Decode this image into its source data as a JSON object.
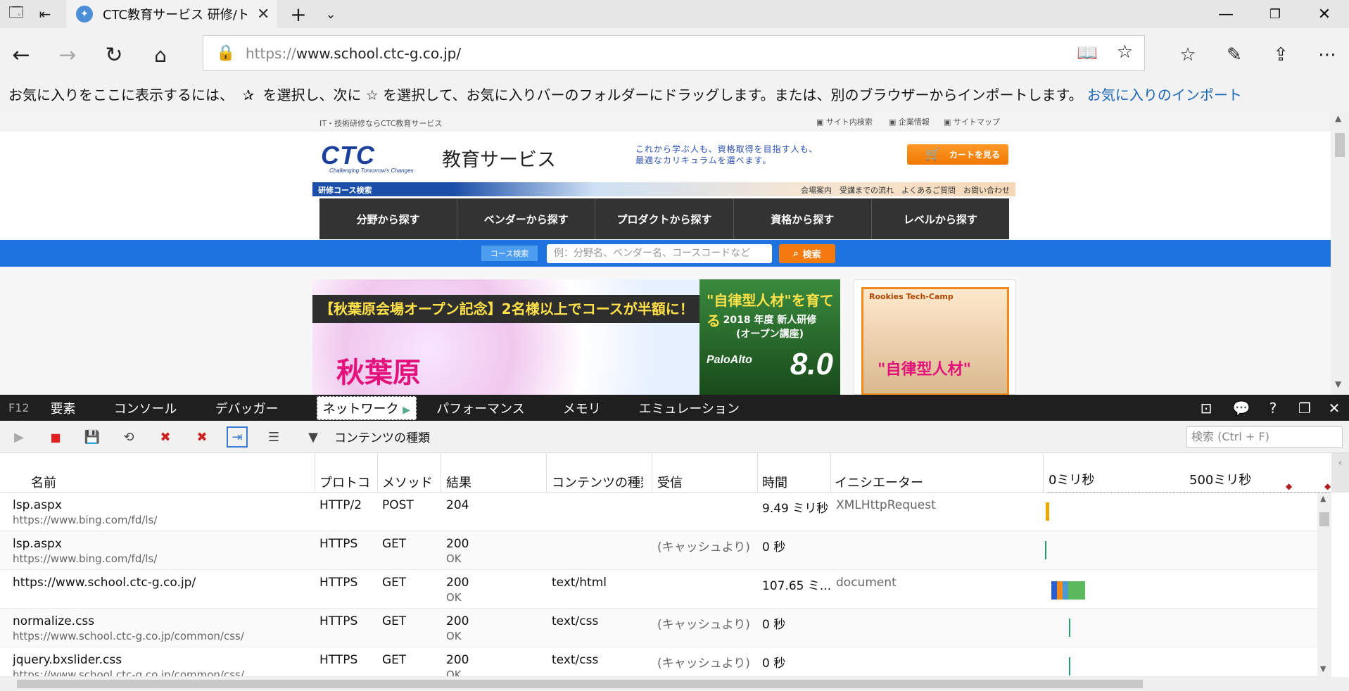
{
  "browser": {
    "tab_title": "CTC教育サービス 研修/トレーニング",
    "url_prefix": "https://",
    "url_main": "www.school.ctc-g.co.jp/"
  },
  "favbar": {
    "text1": "お気に入りをここに表示するには、",
    "text2": "を選択し、次に ☆ を選択して、お気に入りバーのフォルダーにドラッグします。または、別のブラウザーからインポートします。",
    "link": "お気に入りのインポート"
  },
  "site": {
    "top_left": "IT・技術研修ならCTC教育サービス",
    "top_links": [
      "サイト内検索",
      "企業情報",
      "サイトマップ"
    ],
    "logo": "CTC",
    "logo_tag": "Challenging Tomorrow's Changes",
    "edu": "教育サービス",
    "catch1": "これから学ぶ人も、資格取得を目指す人も、",
    "catch2": "最適なカリキュラムを選べます。",
    "cart": "カートを見る",
    "subbar_left": "研修コース検索",
    "subbar_right": "会場案内　受講までの流れ　よくあるご質問　お問い合わせ",
    "menu": [
      "分野から探す",
      "ベンダーから探す",
      "プロダクトから探す",
      "資格から探す",
      "レベルから探す"
    ],
    "search_label": "コース検索",
    "search_placeholder": "例：分野名、ベンダー名、コースコードなど",
    "search_button": "検索",
    "banner1_strip": "【秋葉原会場オープン記念】2名様以上でコースが半額に！",
    "banner1_big": "秋葉原",
    "banner2_h": "\"自律型人材\"を育てる",
    "banner2_m": "2018 年度 新人研修\n(オープン講座)",
    "banner2_pa": "PaloAlto",
    "banner2_v": "8.0",
    "banner3_t1": "Rookies Tech-Camp",
    "banner3_t2": "\"自律型人材\""
  },
  "devtools": {
    "f12": "F12",
    "tabs": [
      "要素",
      "コンソール",
      "デバッガー",
      "ネットワーク",
      "パフォーマンス",
      "メモリ",
      "エミュレーション"
    ],
    "filter": "コンテンツの種類",
    "search_placeholder": "検索 (Ctrl + F)",
    "headers": [
      "名前",
      "プロトコ",
      "メソッド",
      "結果",
      "コンテンツの種類",
      "受信",
      "時間",
      "イニシエーター"
    ],
    "timeline_labels": [
      "0ミリ秒",
      "500ミリ秒"
    ],
    "rows": [
      {
        "name": "lsp.aspx",
        "url": "https://www.bing.com/fd/ls/",
        "protocol": "HTTP/2",
        "method": "POST",
        "status": "204",
        "status_text": "",
        "type": "",
        "received": "",
        "time": "9.49 ミリ秒",
        "initiator": "XMLHttpRequest"
      },
      {
        "name": "lsp.aspx",
        "url": "https://www.bing.com/fd/ls/",
        "protocol": "HTTPS",
        "method": "GET",
        "status": "200",
        "status_text": "OK",
        "type": "",
        "received": "(キャッシュより)",
        "time": "0 秒",
        "initiator": ""
      },
      {
        "name": "https://www.school.ctc-g.co.jp/",
        "url": "",
        "protocol": "HTTPS",
        "method": "GET",
        "status": "200",
        "status_text": "OK",
        "type": "text/html",
        "received": "",
        "time": "107.65 ミ...",
        "initiator": "document"
      },
      {
        "name": "normalize.css",
        "url": "https://www.school.ctc-g.co.jp/common/css/",
        "protocol": "HTTPS",
        "method": "GET",
        "status": "200",
        "status_text": "OK",
        "type": "text/css",
        "received": "(キャッシュより)",
        "time": "0 秒",
        "initiator": ""
      },
      {
        "name": "jquery.bxslider.css",
        "url": "https://www.school.ctc-g.co.jp/common/css/",
        "protocol": "HTTPS",
        "method": "GET",
        "status": "200",
        "status_text": "OK",
        "type": "text/css",
        "received": "(キャッシュより)",
        "time": "0 秒",
        "initiator": ""
      }
    ]
  }
}
